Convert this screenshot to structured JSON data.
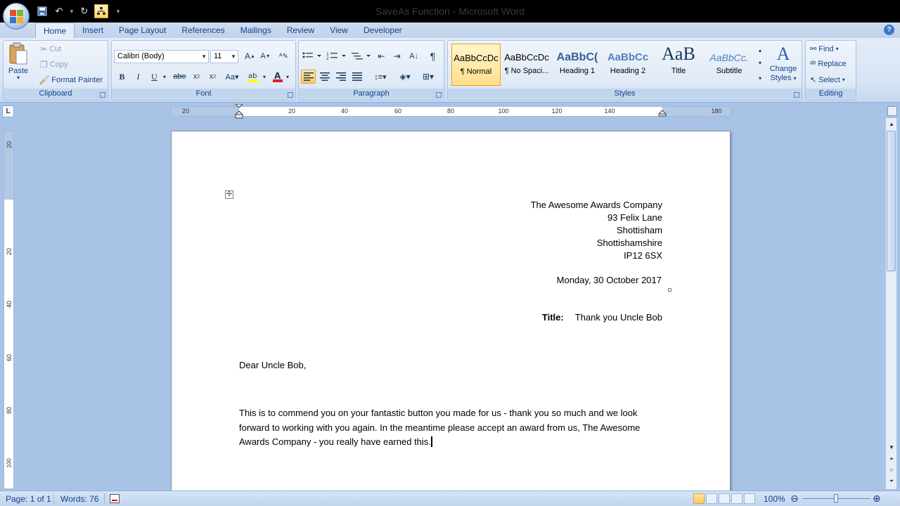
{
  "window": {
    "title": "SaveAs Function - Microsoft Word"
  },
  "tabs": [
    "Home",
    "Insert",
    "Page Layout",
    "References",
    "Mailings",
    "Review",
    "View",
    "Developer"
  ],
  "ribbon": {
    "clipboard": {
      "label": "Clipboard",
      "paste": "Paste",
      "cut": "Cut",
      "copy": "Copy",
      "format_painter": "Format Painter"
    },
    "font": {
      "label": "Font",
      "family": "Calibri (Body)",
      "size": "11"
    },
    "paragraph": {
      "label": "Paragraph"
    },
    "styles": {
      "label": "Styles",
      "items": [
        {
          "sample": "AaBbCcDc",
          "name": "¶ Normal"
        },
        {
          "sample": "AaBbCcDc",
          "name": "¶ No Spaci..."
        },
        {
          "sample": "AaBbC(",
          "name": "Heading 1"
        },
        {
          "sample": "AaBbCc",
          "name": "Heading 2"
        },
        {
          "sample": "AaB",
          "name": "Title"
        },
        {
          "sample": "AaBbCc.",
          "name": "Subtitle"
        }
      ],
      "change_styles_line1": "Change",
      "change_styles_line2": "Styles"
    },
    "editing": {
      "label": "Editing",
      "find": "Find",
      "replace": "Replace",
      "select": "Select"
    }
  },
  "ruler": {
    "h_numbers": [
      "20",
      "20",
      "40",
      "60",
      "80",
      "100",
      "120",
      "140",
      "180"
    ],
    "v_numbers": [
      "20",
      "20",
      "40",
      "60",
      "80",
      "100"
    ]
  },
  "document": {
    "address": [
      "The Awesome Awards Company",
      "93 Felix Lane",
      "Shottisham",
      "Shottishamshire",
      "IP12 6SX"
    ],
    "date": "Monday, 30 October 2017",
    "title_label": "Title:",
    "title_value": "Thank you Uncle Bob",
    "salutation": "Dear Uncle Bob,",
    "body": "This is to commend you on your fantastic button you made for us - thank you so much and we look forward to working with you again.   In the meantime please accept an award from us, The Awesome Awards Company - you really have earned this."
  },
  "status": {
    "page": "Page: 1 of 1",
    "words": "Words: 76",
    "zoom": "100%"
  },
  "colors": {
    "accent": "#15428b",
    "ribbon": "#dfe9f6",
    "selected": "#f9c95e"
  }
}
